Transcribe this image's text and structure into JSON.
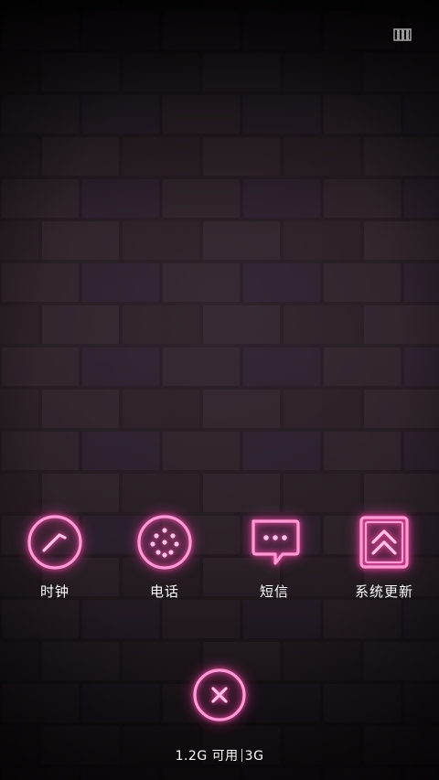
{
  "recents": {
    "icon": "recents-toggle-icon"
  },
  "apps": [
    {
      "label": "时钟",
      "icon": "clock-icon"
    },
    {
      "label": "电话",
      "icon": "phone-dialpad-icon"
    },
    {
      "label": "短信",
      "icon": "message-icon"
    },
    {
      "label": "系统更新",
      "icon": "system-update-icon"
    }
  ],
  "close_all": {
    "icon": "close-icon"
  },
  "memory": {
    "available": "1.2G 可用",
    "total": "3G"
  },
  "colors": {
    "neon": "#ff5cb8",
    "neon_glow": "#ff3ca8",
    "text": "#ffffff",
    "wall": "#241b22"
  }
}
